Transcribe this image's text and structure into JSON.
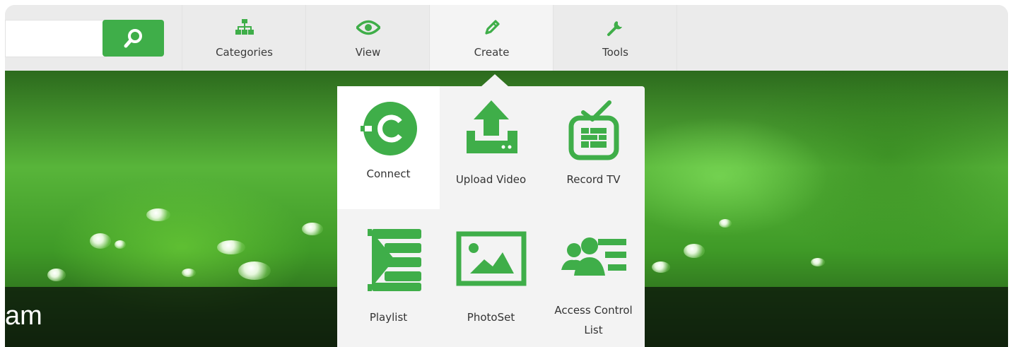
{
  "search": {
    "placeholder": ""
  },
  "nav": {
    "items": [
      {
        "label": "Categories",
        "icon": "sitemap-icon"
      },
      {
        "label": "View",
        "icon": "eye-icon"
      },
      {
        "label": "Create",
        "icon": "pencil-icon",
        "active": true
      },
      {
        "label": "Tools",
        "icon": "wrench-icon"
      }
    ]
  },
  "create_menu": {
    "items": [
      {
        "label": "Connect",
        "icon": "connect-icon"
      },
      {
        "label": "Upload Video",
        "icon": "upload-icon"
      },
      {
        "label": "Record TV",
        "icon": "tv-icon"
      },
      {
        "label": "Playlist",
        "icon": "playlist-icon"
      },
      {
        "label": "PhotoSet",
        "icon": "photo-icon"
      },
      {
        "label": "Access Control List",
        "icon": "users-list-icon"
      }
    ]
  },
  "hero": {
    "title_fragment": "am"
  },
  "colors": {
    "accent": "#3fae49",
    "navbar": "#ebebeb",
    "menu": "#f3f3f3"
  }
}
